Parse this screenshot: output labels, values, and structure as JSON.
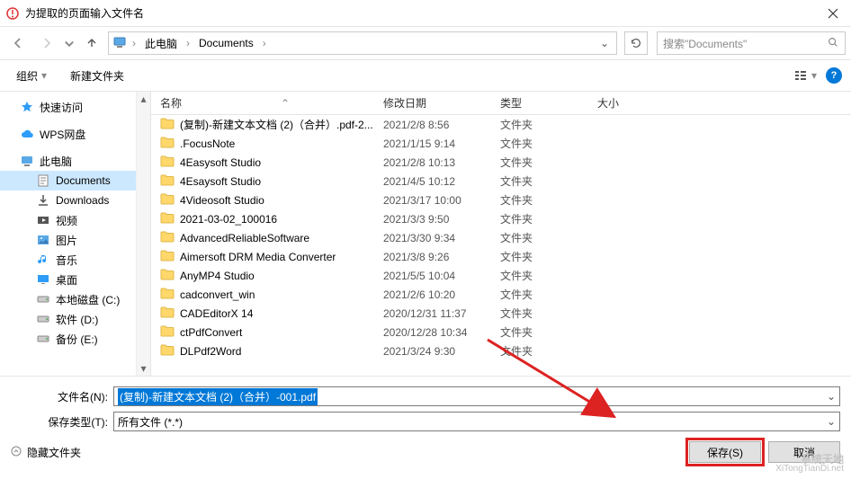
{
  "window": {
    "title": "为提取的页面输入文件名"
  },
  "breadcrumb": {
    "root_icon": "monitor",
    "items": [
      "此电脑",
      "Documents"
    ]
  },
  "search": {
    "placeholder": "搜索\"Documents\""
  },
  "toolbar": {
    "organize": "组织",
    "new_folder": "新建文件夹"
  },
  "sidebar": {
    "items": [
      {
        "icon": "star",
        "label": "快速访问",
        "color": "#2e9df7"
      },
      {
        "icon": "cloud",
        "label": "WPS网盘",
        "color": "#2e9df7"
      },
      {
        "icon": "monitor",
        "label": "此电脑",
        "color": "#555"
      },
      {
        "icon": "doc",
        "label": "Documents",
        "color": "#555",
        "active": true,
        "sub": true
      },
      {
        "icon": "download",
        "label": "Downloads",
        "color": "#555",
        "sub": true
      },
      {
        "icon": "video",
        "label": "视频",
        "color": "#555",
        "sub": true
      },
      {
        "icon": "image",
        "label": "图片",
        "color": "#555",
        "sub": true
      },
      {
        "icon": "music",
        "label": "音乐",
        "color": "#2e9df7",
        "sub": true
      },
      {
        "icon": "desktop",
        "label": "桌面",
        "color": "#2e9df7",
        "sub": true
      },
      {
        "icon": "disk",
        "label": "本地磁盘 (C:)",
        "color": "#888",
        "sub": true
      },
      {
        "icon": "disk",
        "label": "软件 (D:)",
        "color": "#888",
        "sub": true
      },
      {
        "icon": "disk",
        "label": "备份 (E:)",
        "color": "#888",
        "sub": true
      }
    ]
  },
  "columns": {
    "name": "名称",
    "date": "修改日期",
    "type": "类型",
    "size": "大小"
  },
  "files": [
    {
      "name": "(复制)-新建文本文档 (2)（合并）.pdf-2...",
      "date": "2021/2/8 8:56",
      "type": "文件夹"
    },
    {
      "name": ".FocusNote",
      "date": "2021/1/15 9:14",
      "type": "文件夹"
    },
    {
      "name": "4Easysoft Studio",
      "date": "2021/2/8 10:13",
      "type": "文件夹"
    },
    {
      "name": "4Esaysoft Studio",
      "date": "2021/4/5 10:12",
      "type": "文件夹"
    },
    {
      "name": "4Videosoft Studio",
      "date": "2021/3/17 10:00",
      "type": "文件夹"
    },
    {
      "name": "2021-03-02_100016",
      "date": "2021/3/3 9:50",
      "type": "文件夹"
    },
    {
      "name": "AdvancedReliableSoftware",
      "date": "2021/3/30 9:34",
      "type": "文件夹"
    },
    {
      "name": "Aimersoft DRM Media Converter",
      "date": "2021/3/8 9:26",
      "type": "文件夹"
    },
    {
      "name": "AnyMP4 Studio",
      "date": "2021/5/5 10:04",
      "type": "文件夹"
    },
    {
      "name": "cadconvert_win",
      "date": "2021/2/6 10:20",
      "type": "文件夹"
    },
    {
      "name": "CADEditorX 14",
      "date": "2020/12/31 11:37",
      "type": "文件夹"
    },
    {
      "name": "ctPdfConvert",
      "date": "2020/12/28 10:34",
      "type": "文件夹"
    },
    {
      "name": "DLPdf2Word",
      "date": "2021/3/24 9:30",
      "type": "文件夹"
    }
  ],
  "form": {
    "filename_label": "文件名(N):",
    "filename_value": "(复制)-新建文本文档 (2)（合并）-001.pdf",
    "filetype_label": "保存类型(T):",
    "filetype_value": "所有文件 (*.*)",
    "hide_folders": "隐藏文件夹",
    "save": "保存(S)",
    "cancel": "取消"
  },
  "watermark": {
    "main": "系统天地",
    "sub": "XiTongTianDi.net"
  }
}
